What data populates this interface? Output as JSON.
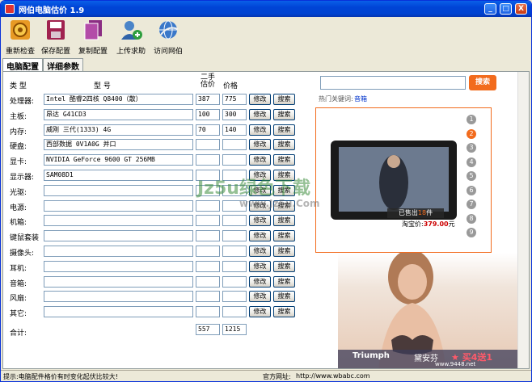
{
  "window": {
    "title": "网伯电脑估价 1.9",
    "min_label": "_",
    "max_label": "□",
    "close_label": "X"
  },
  "toolbar": [
    {
      "label": "重新检查",
      "icon": "gear-icon"
    },
    {
      "label": "保存配置",
      "icon": "disk-icon"
    },
    {
      "label": "复制配置",
      "icon": "copy-icon"
    },
    {
      "label": "上传求助",
      "icon": "user-add-icon"
    },
    {
      "label": "访问网伯",
      "icon": "globe-icon"
    }
  ],
  "tabs": [
    {
      "label": "电脑配置",
      "active": true
    },
    {
      "label": "详细参数",
      "active": false
    }
  ],
  "table": {
    "headers": {
      "type": "类    型",
      "model": "型       号",
      "used_price": "二手\n估价",
      "price": "价格"
    },
    "rows": [
      {
        "label": "处理器:",
        "model": "Intel 酷睿2四核 Q8400（散）",
        "used": "387",
        "price": "775"
      },
      {
        "label": "主板:",
        "model": "昂达 G41CD3",
        "used": "100",
        "price": "300"
      },
      {
        "label": "内存:",
        "model": "威刚 三代(1333) 4G",
        "used": "70",
        "price": "140"
      },
      {
        "label": "硬盘:",
        "model": "西部数据 0V1A0G  并口",
        "used": "",
        "price": ""
      },
      {
        "label": "显卡:",
        "model": "NVIDIA GeForce 9600 GT 256MB",
        "used": "",
        "price": ""
      },
      {
        "label": "显示器:",
        "model": "SAM08D1",
        "used": "",
        "price": ""
      },
      {
        "label": "光驱:",
        "model": "",
        "used": "",
        "price": ""
      },
      {
        "label": "电源:",
        "model": "",
        "used": "",
        "price": ""
      },
      {
        "label": "机箱:",
        "model": "",
        "used": "",
        "price": ""
      },
      {
        "label": "键鼠套装",
        "model": "",
        "used": "",
        "price": ""
      },
      {
        "label": "摄像头:",
        "model": "",
        "used": "",
        "price": ""
      },
      {
        "label": "耳机:",
        "model": "",
        "used": "",
        "price": ""
      },
      {
        "label": "音箱:",
        "model": "",
        "used": "",
        "price": ""
      },
      {
        "label": "风扇:",
        "model": "",
        "used": "",
        "price": ""
      },
      {
        "label": "其它:",
        "model": "",
        "used": "",
        "price": ""
      }
    ],
    "edit_label": "修改",
    "search_label": "搜索",
    "total_label": "合计:",
    "total_used": "557",
    "total_price": "1215"
  },
  "sidebar": {
    "search_value": "",
    "search_button": "搜索",
    "hot_label": "热门关键词:",
    "hot_keyword": "音箱",
    "pager": [
      "1",
      "2",
      "3",
      "4",
      "5",
      "6",
      "7",
      "8",
      "9"
    ],
    "active_page": 1,
    "sold_label": "已售出",
    "sold_count": "18",
    "sold_unit": "件",
    "taobao_label": "淘宝价:",
    "taobao_price": "379.00",
    "taobao_unit": "元",
    "ad_brand": "Triumph",
    "ad_brand_cn": "黛安芬",
    "ad_promo": "★ 买4送1",
    "ad_site": "www.9448.net",
    "watermark": "Jz5u绿色下载",
    "watermark_url": "www.Jz5u.Com"
  },
  "status": {
    "tip": "提示:电脑配件格价有时变化起伏比较大!",
    "site_label": "官方网址:",
    "site_url": "http://www.wbabc.com"
  },
  "colors": {
    "accent_orange": "#F26B1D",
    "title_blue": "#0044D6",
    "link_blue": "#0033CC",
    "price_red": "#CC0000"
  }
}
